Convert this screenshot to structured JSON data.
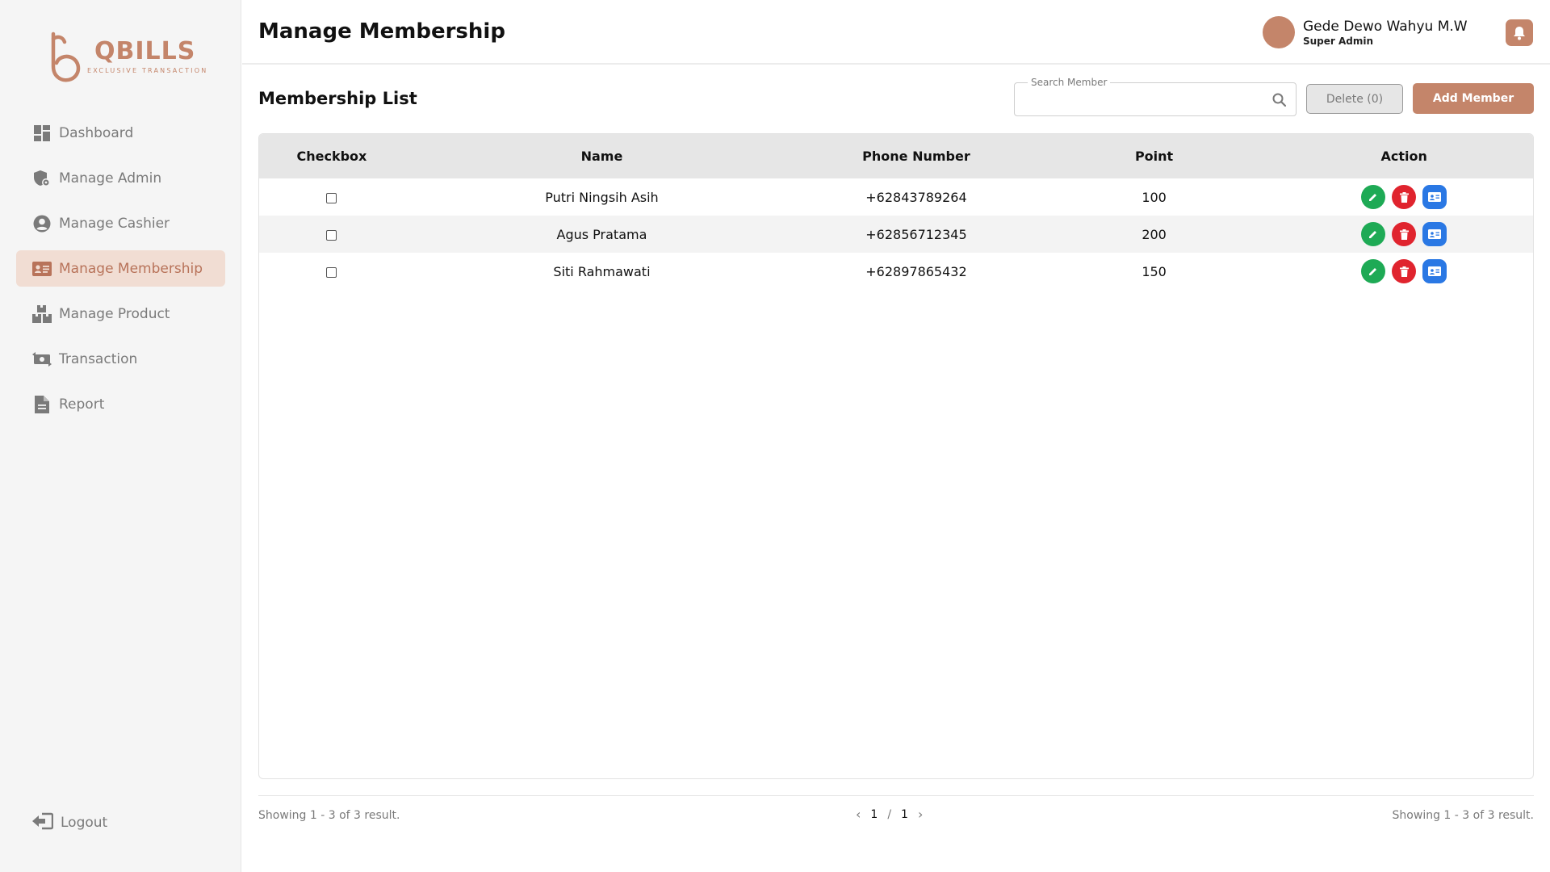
{
  "brand": {
    "name": "QBILLS",
    "tagline": "EXCLUSIVE TRANSACTION",
    "color": "#c4856a"
  },
  "sidebar": {
    "items": [
      {
        "label": "Dashboard",
        "icon": "dashboard-icon",
        "active": false
      },
      {
        "label": "Manage Admin",
        "icon": "admin-shield-icon",
        "active": false
      },
      {
        "label": "Manage Cashier",
        "icon": "user-circle-icon",
        "active": false
      },
      {
        "label": "Manage Membership",
        "icon": "id-card-icon",
        "active": true
      },
      {
        "label": "Manage Product",
        "icon": "boxes-icon",
        "active": false
      },
      {
        "label": "Transaction",
        "icon": "money-transfer-icon",
        "active": false
      },
      {
        "label": "Report",
        "icon": "document-icon",
        "active": false
      }
    ],
    "logout_label": "Logout"
  },
  "header": {
    "title": "Manage Membership",
    "user_name": "Gede Dewo Wahyu M.W",
    "user_role": "Super Admin"
  },
  "main": {
    "list_title": "Membership List",
    "search_label": "Search Member",
    "search_value": "",
    "delete_label": "Delete (0)",
    "add_label": "Add Member"
  },
  "table": {
    "columns": [
      "Checkbox",
      "Name",
      "Phone Number",
      "Point",
      "Action"
    ],
    "rows": [
      {
        "name": "Putri Ningsih Asih",
        "phone": "+62843789264",
        "point": "100"
      },
      {
        "name": "Agus Pratama",
        "phone": "+62856712345",
        "point": "200"
      },
      {
        "name": "Siti Rahmawati",
        "phone": "+62897865432",
        "point": "150"
      }
    ]
  },
  "footer": {
    "showing_left": "Showing 1 - 3 of 3 result.",
    "showing_right": "Showing 1 - 3 of 3 result.",
    "current_page": "1",
    "page_separator": "/",
    "total_pages": "1"
  },
  "colors": {
    "accent": "#c4856a",
    "edit": "#1eaa55",
    "delete": "#e0242e",
    "info": "#2a78e4"
  }
}
